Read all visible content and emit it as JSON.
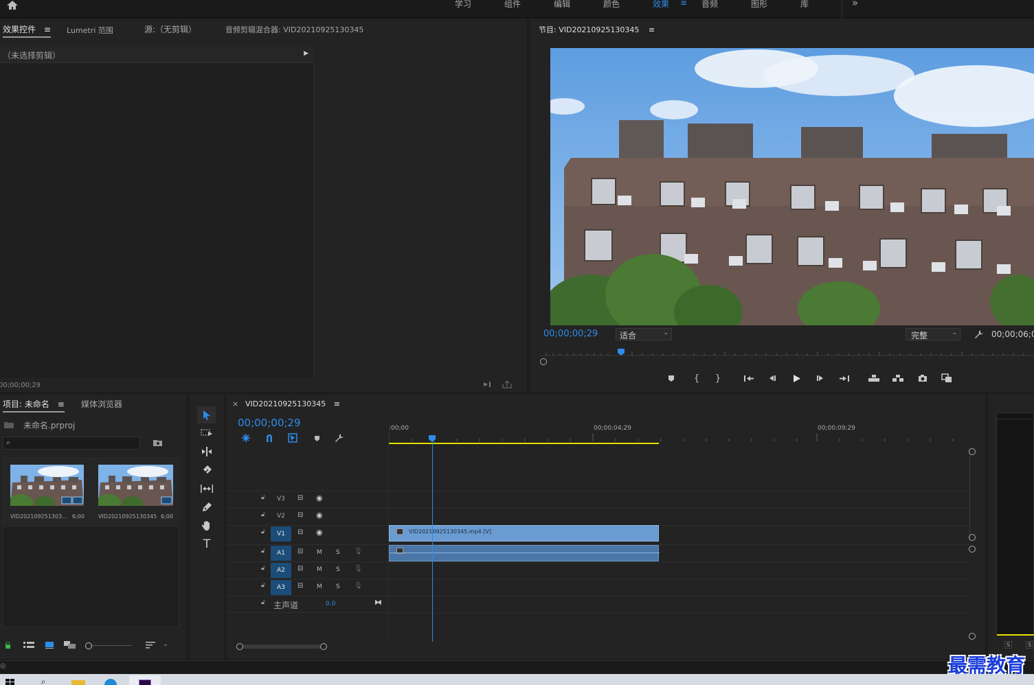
{
  "workspaces": {
    "tabs": [
      {
        "label": "学习"
      },
      {
        "label": "组件"
      },
      {
        "label": "编辑"
      },
      {
        "label": "颜色"
      },
      {
        "label": "效果",
        "active": true
      },
      {
        "label": "音频"
      },
      {
        "label": "图形"
      },
      {
        "label": "库"
      }
    ],
    "overflow": "»"
  },
  "source_panel": {
    "tabs": [
      "效果控件",
      "Lumetri 范围",
      "源:（无剪辑）",
      "音频剪辑混合器: VID20210925130345"
    ],
    "active_tab": "效果控件",
    "no_clip_label": "（未选择剪辑）",
    "timecode": "00;00;00;29"
  },
  "program_monitor": {
    "title": "节目: VID20210925130345",
    "current_timecode": "00;00;00;29",
    "zoom_select": "适合",
    "quality_select": "完整",
    "duration_timecode": "00;00;06;0"
  },
  "project_panel": {
    "tabs": [
      "项目: 未命名",
      "媒体浏览器"
    ],
    "project_file": "未命名.prproj",
    "search_placeholder": "",
    "items": [
      {
        "name": "VID202109251303...",
        "duration": "6;00"
      },
      {
        "name": "VID20210925130345",
        "duration": "6;00"
      }
    ]
  },
  "timeline": {
    "tab_close": "×",
    "sequence_name": "VID20210925130345",
    "timecode": "00;00;00;29",
    "ruler_labels": [
      ":00;00",
      "00;00;04;29",
      "00;00;09;29"
    ],
    "video_tracks": [
      "V3",
      "V2",
      "V1"
    ],
    "audio_tracks": [
      "A1",
      "A2",
      "A3"
    ],
    "mute_label": "M",
    "solo_label": "S",
    "master_label": "主声道",
    "master_value": "0.0",
    "clip_label": "VID20210925130345.mp4 [V]"
  },
  "audio_meter": {
    "labels": [
      "S",
      "S"
    ]
  },
  "watermark": "最需教育",
  "colors": {
    "accent": "#2d8ceb",
    "clip_video": "#6a9bd1",
    "clip_audio": "#4a77a8",
    "work_area": "#e8e000",
    "panel_bg": "#232323"
  }
}
